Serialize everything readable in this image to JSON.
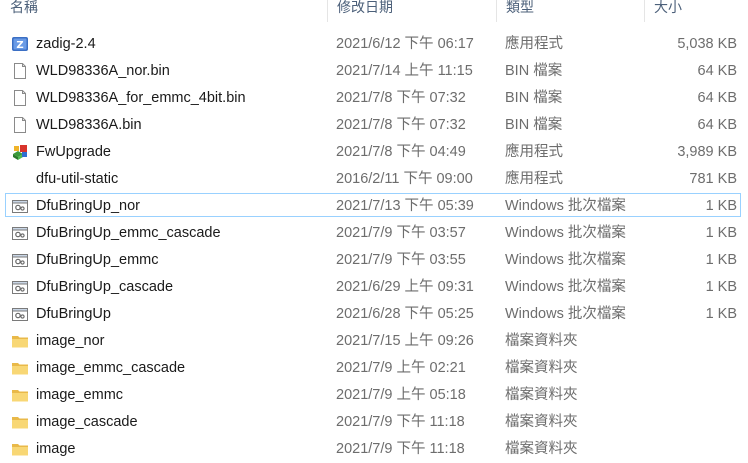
{
  "columns": {
    "name": "名稱",
    "date": "修改日期",
    "type": "類型",
    "size": "大小"
  },
  "files": [
    {
      "name": "zadig-2.4",
      "date": "2021/6/12 下午 06:17",
      "type": "應用程式",
      "size": "5,038 KB",
      "icon": "zadig-app-icon"
    },
    {
      "name": "WLD98336A_nor.bin",
      "date": "2021/7/14 上午 11:15",
      "type": "BIN 檔案",
      "size": "64 KB",
      "icon": "document-icon"
    },
    {
      "name": "WLD98336A_for_emmc_4bit.bin",
      "date": "2021/7/8 下午 07:32",
      "type": "BIN 檔案",
      "size": "64 KB",
      "icon": "document-icon"
    },
    {
      "name": "WLD98336A.bin",
      "date": "2021/7/8 下午 07:32",
      "type": "BIN 檔案",
      "size": "64 KB",
      "icon": "document-icon"
    },
    {
      "name": "FwUpgrade",
      "date": "2021/7/8 下午 04:49",
      "type": "應用程式",
      "size": "3,989 KB",
      "icon": "installer-app-icon"
    },
    {
      "name": "dfu-util-static",
      "date": "2016/2/11 下午 09:00",
      "type": "應用程式",
      "size": "781 KB",
      "icon": "blank-app-icon"
    },
    {
      "name": "DfuBringUp_nor",
      "date": "2021/7/13 下午 05:39",
      "type": "Windows 批次檔案",
      "size": "1 KB",
      "icon": "batch-file-icon",
      "selected": true
    },
    {
      "name": "DfuBringUp_emmc_cascade",
      "date": "2021/7/9 下午 03:57",
      "type": "Windows 批次檔案",
      "size": "1 KB",
      "icon": "batch-file-icon"
    },
    {
      "name": "DfuBringUp_emmc",
      "date": "2021/7/9 下午 03:55",
      "type": "Windows 批次檔案",
      "size": "1 KB",
      "icon": "batch-file-icon"
    },
    {
      "name": "DfuBringUp_cascade",
      "date": "2021/6/29 上午 09:31",
      "type": "Windows 批次檔案",
      "size": "1 KB",
      "icon": "batch-file-icon"
    },
    {
      "name": "DfuBringUp",
      "date": "2021/6/28 下午 05:25",
      "type": "Windows 批次檔案",
      "size": "1 KB",
      "icon": "batch-file-icon"
    },
    {
      "name": "image_nor",
      "date": "2021/7/15 上午 09:26",
      "type": "檔案資料夾",
      "size": "",
      "icon": "folder-icon"
    },
    {
      "name": "image_emmc_cascade",
      "date": "2021/7/9 上午 02:21",
      "type": "檔案資料夾",
      "size": "",
      "icon": "folder-icon"
    },
    {
      "name": "image_emmc",
      "date": "2021/7/9 上午 05:18",
      "type": "檔案資料夾",
      "size": "",
      "icon": "folder-icon"
    },
    {
      "name": "image_cascade",
      "date": "2021/7/9 下午 11:18",
      "type": "檔案資料夾",
      "size": "",
      "icon": "folder-icon"
    },
    {
      "name": "image",
      "date": "2021/7/9 下午 11:18",
      "type": "檔案資料夾",
      "size": "",
      "icon": "folder-icon"
    }
  ],
  "colors": {
    "header_text": "#4c607a",
    "selection_border": "#99d1ff",
    "folder": "#f8d775"
  }
}
